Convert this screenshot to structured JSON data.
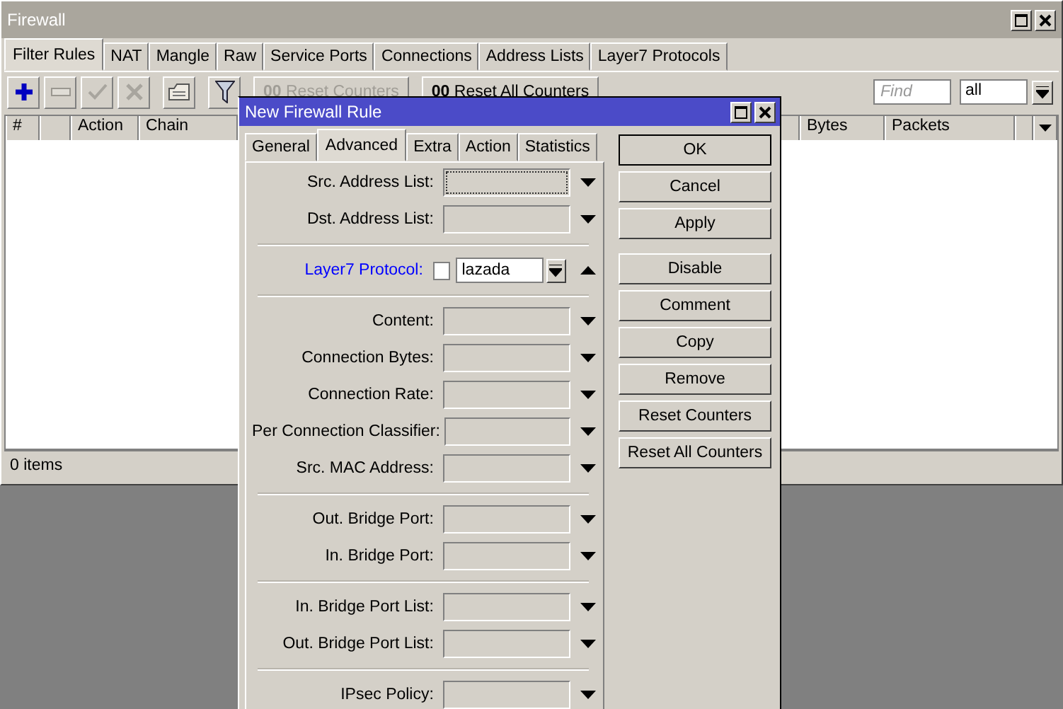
{
  "window": {
    "title": "Firewall"
  },
  "tabs": [
    {
      "label": "Filter Rules",
      "selected": true
    },
    {
      "label": "NAT",
      "selected": false
    },
    {
      "label": "Mangle",
      "selected": false
    },
    {
      "label": "Raw",
      "selected": false
    },
    {
      "label": "Service Ports",
      "selected": false
    },
    {
      "label": "Connections",
      "selected": false
    },
    {
      "label": "Address Lists",
      "selected": false
    },
    {
      "label": "Layer7 Protocols",
      "selected": false
    }
  ],
  "toolbar": {
    "tools": [
      {
        "kind": "add",
        "disabled": false
      },
      {
        "kind": "remove",
        "disabled": false
      },
      {
        "kind": "enable",
        "disabled": true
      },
      {
        "kind": "disable",
        "disabled": true
      },
      {
        "kind": "comment",
        "disabled": false
      },
      {
        "kind": "filter",
        "disabled": false
      }
    ],
    "counter_buttons": [
      {
        "icon": "00",
        "label": "Reset Counters",
        "disabled": true
      },
      {
        "icon": "00",
        "label": "Reset All Counters",
        "disabled": false
      }
    ],
    "find": {
      "placeholder": "Find"
    },
    "filter_select": {
      "value": "all"
    }
  },
  "table": {
    "columns": [
      {
        "kind": "text",
        "label": "#"
      },
      {
        "kind": "blank"
      },
      {
        "kind": "text",
        "label": "Action"
      },
      {
        "kind": "text",
        "label": "Chain"
      },
      {
        "kind": "gap"
      },
      {
        "kind": "text",
        "label": "Bytes"
      },
      {
        "kind": "text",
        "label": "Packets"
      },
      {
        "kind": "blank"
      },
      {
        "kind": "menu"
      }
    ]
  },
  "status_bar": "0 items",
  "dialog": {
    "title": "New Firewall Rule",
    "tabs": [
      {
        "label": "General",
        "selected": false
      },
      {
        "label": "Advanced",
        "selected": true
      },
      {
        "label": "Extra",
        "selected": false
      },
      {
        "label": "Action",
        "selected": false
      },
      {
        "label": "Statistics",
        "selected": false
      }
    ],
    "groups": [
      [
        {
          "kind": "combo",
          "label": "Src. Address List:",
          "focused": true
        },
        {
          "kind": "combo",
          "label": "Dst. Address List:",
          "focused": false
        }
      ],
      [
        {
          "kind": "layer7",
          "label": "Layer7 Protocol:",
          "negated": false,
          "value": "lazada"
        }
      ],
      [
        {
          "kind": "combo",
          "label": "Content:",
          "focused": false
        },
        {
          "kind": "combo",
          "label": "Connection Bytes:",
          "focused": false
        },
        {
          "kind": "combo",
          "label": "Connection Rate:",
          "focused": false
        },
        {
          "kind": "combo",
          "label": "Per Connection Classifier:",
          "focused": false
        },
        {
          "kind": "combo",
          "label": "Src. MAC Address:",
          "focused": false
        }
      ],
      [
        {
          "kind": "combo",
          "label": "Out. Bridge Port:",
          "focused": false
        },
        {
          "kind": "combo",
          "label": "In. Bridge Port:",
          "focused": false
        }
      ],
      [
        {
          "kind": "combo",
          "label": "In. Bridge Port List:",
          "focused": false
        },
        {
          "kind": "combo",
          "label": "Out. Bridge Port List:",
          "focused": false
        }
      ],
      [
        {
          "kind": "combo",
          "label": "IPsec Policy:",
          "focused": false
        }
      ]
    ],
    "button_groups": [
      [
        {
          "label": "OK",
          "default": true
        },
        {
          "label": "Cancel",
          "default": false
        },
        {
          "label": "Apply",
          "default": false
        }
      ],
      [
        {
          "label": "Disable",
          "default": false
        },
        {
          "label": "Comment",
          "default": false
        },
        {
          "label": "Copy",
          "default": false
        },
        {
          "label": "Remove",
          "default": false
        },
        {
          "label": "Reset Counters",
          "default": false
        },
        {
          "label": "Reset All Counters",
          "default": false
        }
      ]
    ]
  }
}
